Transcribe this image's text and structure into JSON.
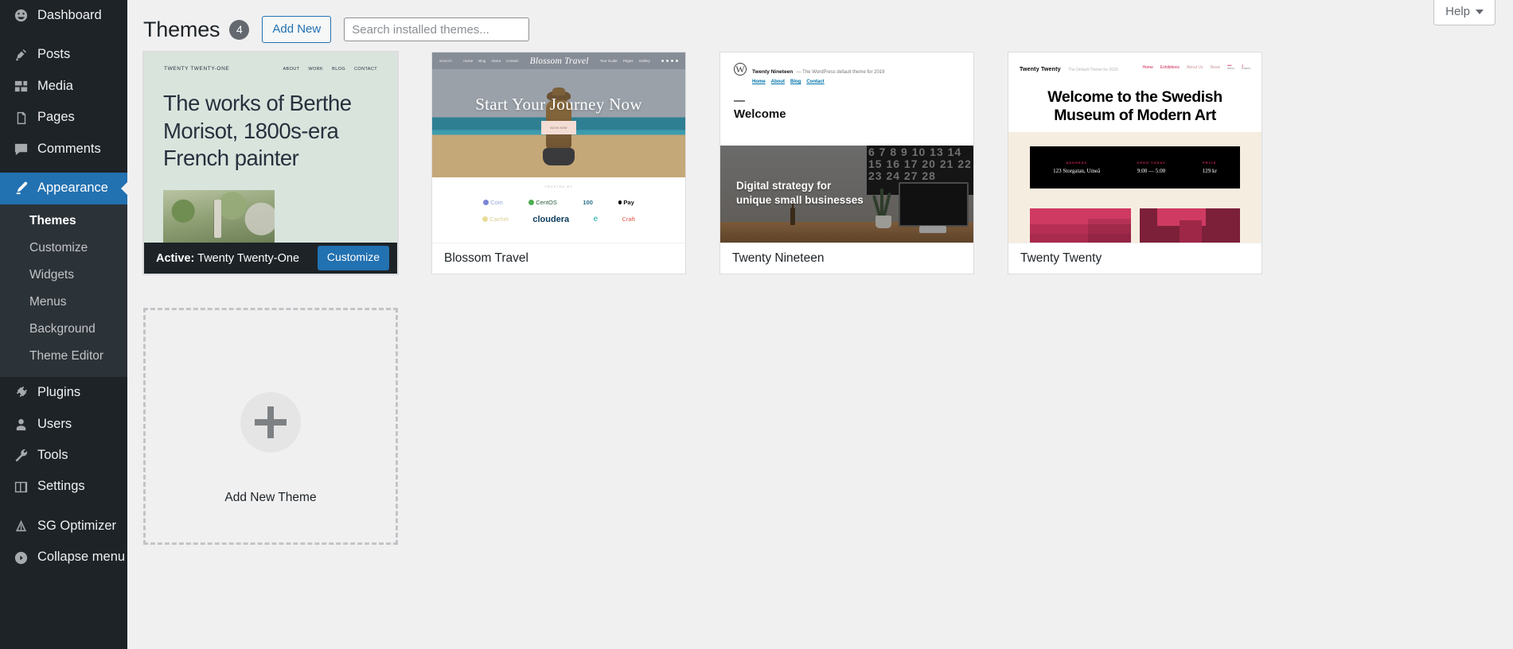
{
  "sidebar": {
    "items": [
      {
        "label": "Dashboard",
        "icon": "dashboard-icon"
      },
      {
        "label": "Posts",
        "icon": "posts-pin-icon"
      },
      {
        "label": "Media",
        "icon": "media-icon"
      },
      {
        "label": "Pages",
        "icon": "pages-icon"
      },
      {
        "label": "Comments",
        "icon": "comments-icon"
      },
      {
        "label": "Appearance",
        "icon": "appearance-brush-icon"
      },
      {
        "label": "Plugins",
        "icon": "plugins-icon"
      },
      {
        "label": "Users",
        "icon": "users-icon"
      },
      {
        "label": "Tools",
        "icon": "tools-wrench-icon"
      },
      {
        "label": "Settings",
        "icon": "settings-sliders-icon"
      },
      {
        "label": "SG Optimizer",
        "icon": "sg-optimizer-icon"
      },
      {
        "label": "Collapse menu",
        "icon": "collapse-arrow-icon"
      }
    ],
    "appearance_submenu": [
      {
        "label": "Themes",
        "active": true
      },
      {
        "label": "Customize",
        "active": false
      },
      {
        "label": "Widgets",
        "active": false
      },
      {
        "label": "Menus",
        "active": false
      },
      {
        "label": "Background",
        "active": false
      },
      {
        "label": "Theme Editor",
        "active": false
      }
    ],
    "active_color": "#2271b1",
    "bg_color": "#1d2327",
    "submenu_bg_color": "#2c3338"
  },
  "help": {
    "label": "Help",
    "icon": "chevron-down-icon"
  },
  "header": {
    "title": "Themes",
    "count": "4",
    "add_new_label": "Add New",
    "search_placeholder": "Search installed themes...",
    "search_value": ""
  },
  "themes": [
    {
      "name": "Twenty Twenty-One",
      "active": true,
      "active_prefix": "Active:",
      "customize_label": "Customize",
      "screenshot": {
        "kind": "twenty-twenty-one",
        "brand": "TWENTY TWENTY-ONE",
        "nav": [
          "ABOUT",
          "WORK",
          "BLOG",
          "CONTACT"
        ],
        "headline": "The works of Berthe Morisot, 1800s-era French painter",
        "bg_color": "#d9e4dd"
      }
    },
    {
      "name": "Blossom Travel",
      "active": false,
      "screenshot": {
        "kind": "blossom-travel",
        "logo": "Blossom Travel",
        "search_label": "Search",
        "nav_left": [
          "Home",
          "Blog",
          "About",
          "Contact"
        ],
        "nav_right": [
          "Tour Guide",
          "Pages",
          "Gallery"
        ],
        "hero_title": "Start Your Journey Now",
        "sign_text": "BOOK NOW",
        "logos_caption": "TRUSTED BY",
        "logos_row1": [
          "Coin",
          "CentOS",
          "100",
          "Pay"
        ],
        "logos_row2": [
          "Cachet",
          "cloudera",
          "e",
          "Craft"
        ]
      }
    },
    {
      "name": "Twenty Nineteen",
      "active": false,
      "screenshot": {
        "kind": "twenty-nineteen",
        "site_title": "Twenty Nineteen",
        "site_desc": "— The WordPress default theme for 2019",
        "nav": [
          "Home",
          "About",
          "Blog",
          "Contact"
        ],
        "welcome": "Welcome",
        "hero_line1": "Digital strategy for",
        "hero_line2": "unique small businesses",
        "wall_numbers": "6 7 8 9 10 13 14 15 16 17 20 21 22 23 24 27 28"
      }
    },
    {
      "name": "Twenty Twenty",
      "active": false,
      "screenshot": {
        "kind": "twenty-twenty",
        "brand": "Twenty Twenty",
        "tagline": "The Default Theme for 2020",
        "nav": [
          "Home",
          "Exhibitions",
          "About Us",
          "News"
        ],
        "menu_label": "Menu",
        "search_label": "Search",
        "headline_line1": "Welcome to the Swedish",
        "headline_line2": "Museum of Modern Art",
        "info": [
          {
            "label": "ADDRESS",
            "value": "123 Storgatan, Umeå"
          },
          {
            "label": "OPEN TODAY",
            "value": "9:00 — 5:00"
          },
          {
            "label": "PRICE",
            "value": "129 kr"
          }
        ]
      }
    }
  ],
  "add_new_theme": {
    "label": "Add New Theme",
    "icon": "plus-icon"
  }
}
